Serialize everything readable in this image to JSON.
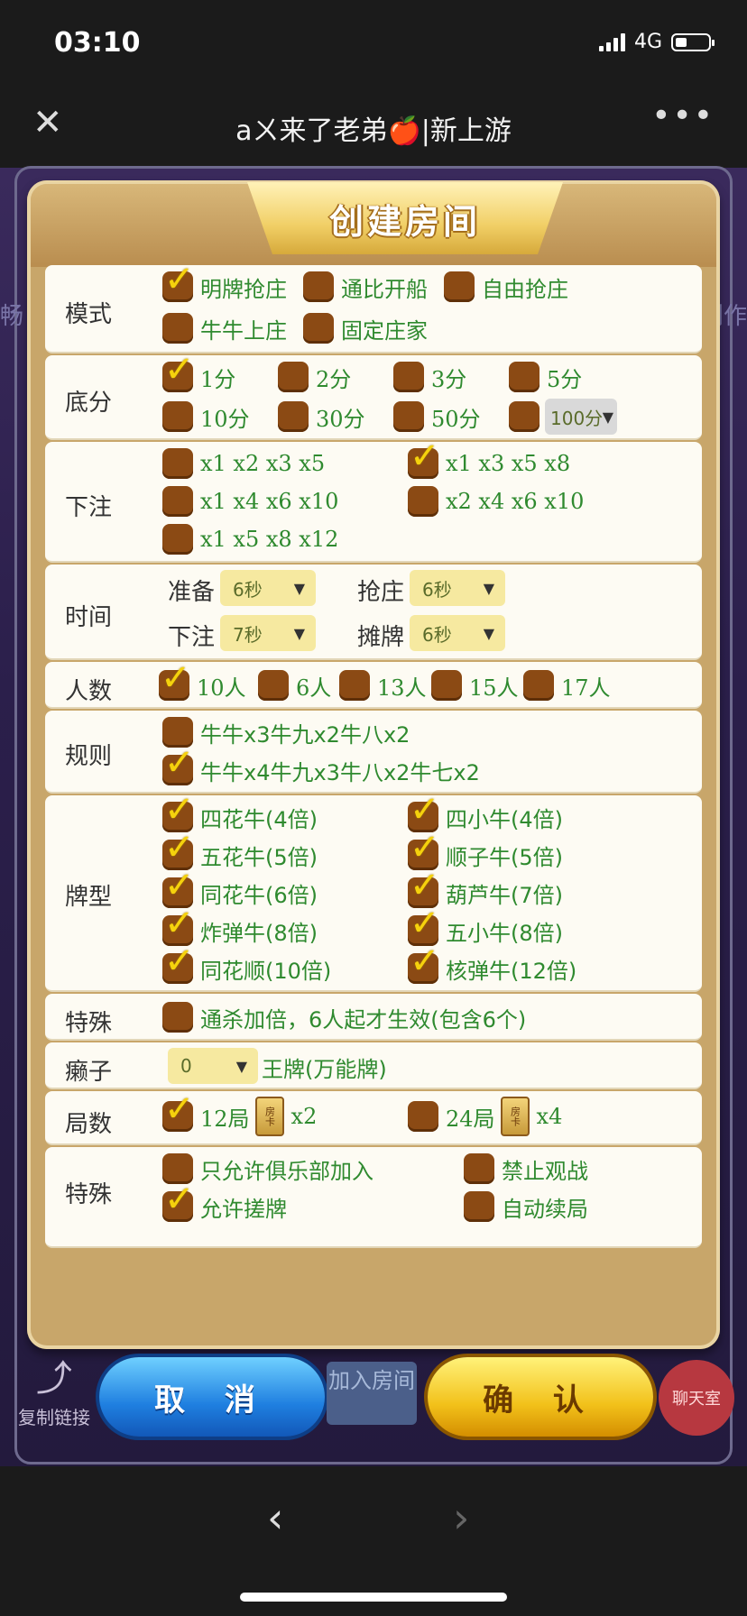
{
  "status": {
    "time": "03:10",
    "network": "4G"
  },
  "nav": {
    "title": "aㄨ来了老弟🍎|新上游",
    "close_icon": "close-icon",
    "more_icon": "more-icon"
  },
  "edges": {
    "left": "畅",
    "right": "创作"
  },
  "dialog": {
    "title": "创建房间"
  },
  "sections": {
    "mode": {
      "label": "模式",
      "options": [
        {
          "text": "明牌抢庄",
          "checked": true
        },
        {
          "text": "通比开船",
          "checked": false
        },
        {
          "text": "自由抢庄",
          "checked": false
        },
        {
          "text": "牛牛上庄",
          "checked": false
        },
        {
          "text": "固定庄家",
          "checked": false
        }
      ]
    },
    "base": {
      "label": "底分",
      "options": [
        {
          "text": "1分",
          "checked": true
        },
        {
          "text": "2分",
          "checked": false
        },
        {
          "text": "3分",
          "checked": false
        },
        {
          "text": "5分",
          "checked": false
        },
        {
          "text": "10分",
          "checked": false
        },
        {
          "text": "30分",
          "checked": false
        },
        {
          "text": "50分",
          "checked": false
        },
        {
          "text": "",
          "checked": false
        }
      ],
      "select_value": "100分"
    },
    "bet": {
      "label": "下注",
      "options": [
        {
          "text": "x1 x2 x3 x5",
          "checked": false
        },
        {
          "text": "x1 x3 x5 x8",
          "checked": true
        },
        {
          "text": "x1 x4 x6 x10",
          "checked": false
        },
        {
          "text": "x2 x4 x6 x10",
          "checked": false
        },
        {
          "text": "x1 x5 x8 x12",
          "checked": false
        }
      ]
    },
    "time": {
      "label": "时间",
      "ready": {
        "label": "准备",
        "value": "6秒"
      },
      "grab": {
        "label": "抢庄",
        "value": "6秒"
      },
      "bet": {
        "label": "下注",
        "value": "7秒"
      },
      "show": {
        "label": "摊牌",
        "value": "6秒"
      }
    },
    "players": {
      "label": "人数",
      "options": [
        {
          "text": "10人",
          "checked": true
        },
        {
          "text": "6人",
          "checked": false
        },
        {
          "text": "13人",
          "checked": false
        },
        {
          "text": "15人",
          "checked": false
        },
        {
          "text": "17人",
          "checked": false
        }
      ]
    },
    "rules": {
      "label": "规则",
      "options": [
        {
          "text": "牛牛x3牛九x2牛八x2",
          "checked": false
        },
        {
          "text": "牛牛x4牛九x3牛八x2牛七x2",
          "checked": true
        }
      ]
    },
    "cards": {
      "label": "牌型",
      "options": [
        {
          "text": "四花牛(4倍)",
          "checked": true
        },
        {
          "text": "四小牛(4倍)",
          "checked": true
        },
        {
          "text": "五花牛(5倍)",
          "checked": true
        },
        {
          "text": "顺子牛(5倍)",
          "checked": true
        },
        {
          "text": "同花牛(6倍)",
          "checked": true
        },
        {
          "text": "葫芦牛(7倍)",
          "checked": true
        },
        {
          "text": "炸弹牛(8倍)",
          "checked": true
        },
        {
          "text": "五小牛(8倍)",
          "checked": true
        },
        {
          "text": "同花顺(10倍)",
          "checked": true
        },
        {
          "text": "核弹牛(12倍)",
          "checked": true
        }
      ]
    },
    "special1": {
      "label": "特殊",
      "options": [
        {
          "text": "通杀加倍，6人起才生效(包含6个)",
          "checked": false
        }
      ]
    },
    "wild": {
      "label": "癞子",
      "select_value": "0",
      "text": "王牌(万能牌)"
    },
    "rounds": {
      "label": "局数",
      "options": [
        {
          "text": "12局",
          "checked": true,
          "cost": "x2"
        },
        {
          "text": "24局",
          "checked": false,
          "cost": "x4"
        }
      ],
      "card_text": "房卡"
    },
    "special2": {
      "label": "特殊",
      "options": [
        {
          "text": "只允许俱乐部加入",
          "checked": false
        },
        {
          "text": "禁止观战",
          "checked": false
        },
        {
          "text": "允许搓牌",
          "checked": true
        },
        {
          "text": "自动续局",
          "checked": false
        }
      ]
    }
  },
  "toolbar": {
    "share_label": "复制链接",
    "cancel_label": "取 消",
    "join_label": "加入房间",
    "confirm_label": "确 认",
    "chat_label": "聊天室"
  }
}
